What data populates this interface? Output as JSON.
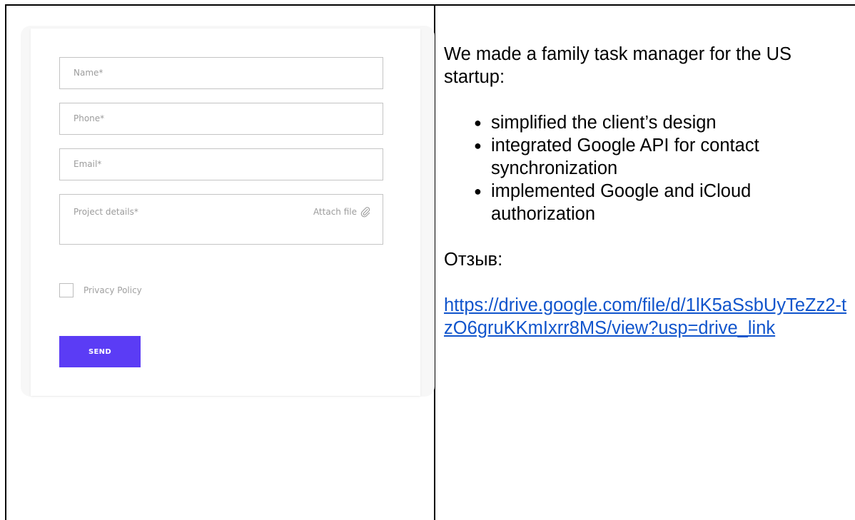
{
  "form": {
    "fields": {
      "name_placeholder": "Name*",
      "phone_placeholder": "Phone*",
      "email_placeholder": "Email*",
      "details_placeholder": "Project details*"
    },
    "attach_label": "Attach file",
    "privacy_label": "Privacy Policy",
    "send_label": "SEND",
    "accent_color": "#5b3cf5"
  },
  "description": {
    "intro": "We made a family task manager for the US startup:",
    "bullets": [
      "simplified the client’s design",
      "integrated Google API for contact synchronization",
      "implemented Google and iCloud authorization"
    ],
    "review_label": "Отзыв:",
    "review_link": "https://drive.google.com/file/d/1lK5aSsbUyTeZz2-tzO6gruKKmIxrr8MS/view?usp=drive_link",
    "link_color": "#1155cc"
  }
}
